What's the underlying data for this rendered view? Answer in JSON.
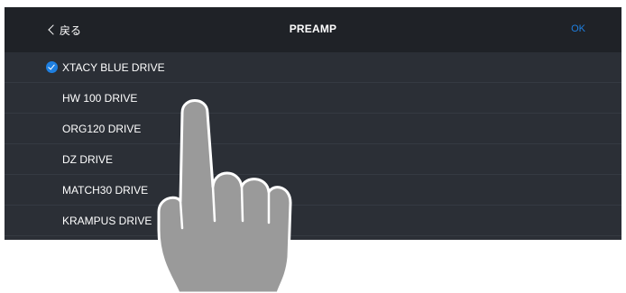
{
  "navbar": {
    "back_label": "戻る",
    "title": "PREAMP",
    "ok_label": "OK"
  },
  "preamp_list": [
    {
      "label": "XTACY BLUE DRIVE",
      "selected": true
    },
    {
      "label": "HW 100 DRIVE",
      "selected": false
    },
    {
      "label": "ORG120 DRIVE",
      "selected": false
    },
    {
      "label": "DZ DRIVE",
      "selected": false
    },
    {
      "label": "MATCH30 DRIVE",
      "selected": false
    },
    {
      "label": "KRAMPUS DRIVE",
      "selected": false
    }
  ],
  "icons": {
    "back": "chevron-left-icon",
    "selected": "checkmark-circle-icon",
    "gesture": "tap-hand-icon"
  },
  "colors": {
    "background": "#2b2f36",
    "navbar": "#1f2227",
    "accent": "#1e7fe0",
    "hand_fill": "#9a9a9a"
  }
}
